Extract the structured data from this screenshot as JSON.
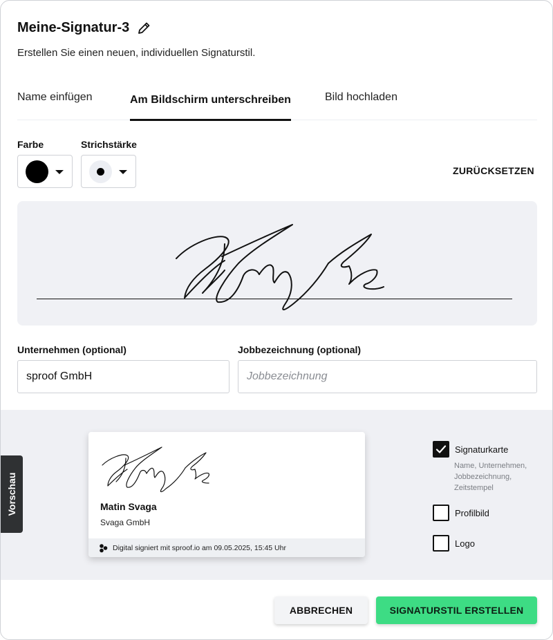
{
  "dialog": {
    "title": "Meine-Signatur-3",
    "subtitle": "Erstellen Sie einen neuen, individuellen Signaturstil."
  },
  "tabs": [
    {
      "label": "Name einfügen",
      "active": false
    },
    {
      "label": "Am Bildschirm unterschreiben",
      "active": true
    },
    {
      "label": "Bild hochladen",
      "active": false
    }
  ],
  "toolbar": {
    "color_label": "Farbe",
    "color_value": "#000000",
    "stroke_label": "Strichstärke",
    "reset_label": "ZURÜCKSETZEN"
  },
  "form": {
    "company_label": "Unternehmen (optional)",
    "company_value": "sproof GmbH",
    "job_label": "Jobbezeichnung (optional)",
    "job_placeholder": "Jobbezeichnung"
  },
  "preview": {
    "tab_label": "Vorschau",
    "card": {
      "name": "Matin Svaga",
      "company": "Svaga GmbH",
      "footer": "Digital signiert mit sproof.io am 09.05.2025, 15:45 Uhr"
    },
    "options": {
      "signature_card_label": "Signaturkarte",
      "signature_card_checked": true,
      "signature_card_desc": "Name, Unternehmen, Jobbezeichnung, Zeitstempel",
      "profile_label": "Profilbild",
      "profile_checked": false,
      "logo_label": "Logo",
      "logo_checked": false
    }
  },
  "actions": {
    "cancel_label": "ABBRECHEN",
    "create_label": "SIGNATURSTIL ERSTELLEN"
  },
  "colors": {
    "accent_green": "#3ddc84",
    "canvas_bg": "#f0f1f5",
    "preview_bg": "#eff0f4"
  }
}
